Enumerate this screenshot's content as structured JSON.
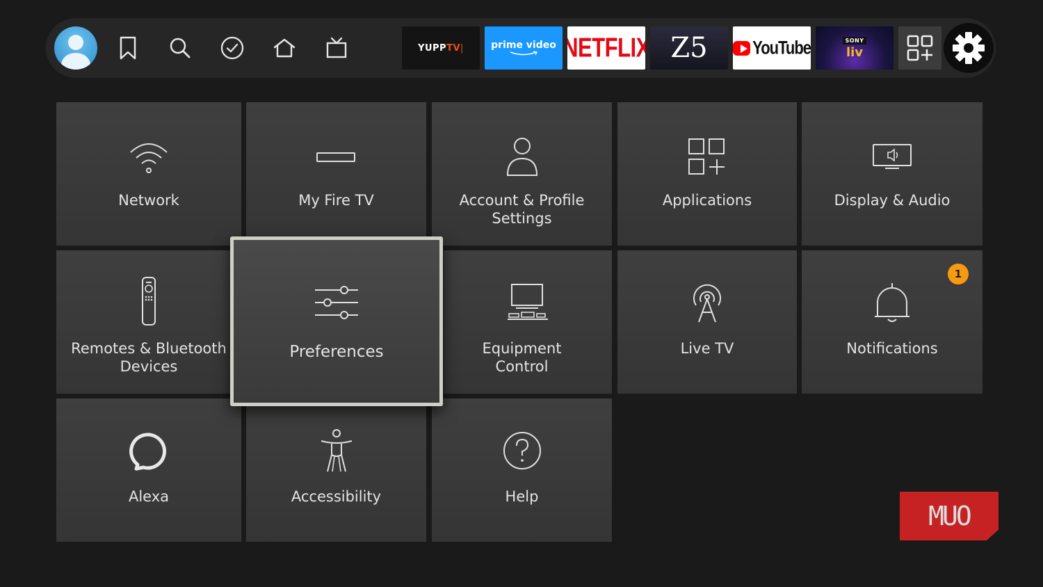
{
  "nav": {
    "items": [
      {
        "icon": "profile-avatar"
      },
      {
        "icon": "bookmark-icon"
      },
      {
        "icon": "search-icon"
      },
      {
        "icon": "checkmark-icon"
      },
      {
        "icon": "home-icon"
      },
      {
        "icon": "live-tv-icon"
      }
    ]
  },
  "apps": {
    "yupptv": {
      "main": "YUPP",
      "accent": "TV",
      "suffix": "|"
    },
    "prime": {
      "label": "prime video"
    },
    "netflix": {
      "label": "NETFLIX"
    },
    "z5": {
      "label": "Z5"
    },
    "youtube": {
      "label": "YouTube"
    },
    "sonyliv": {
      "brand": "SONY",
      "label": "liv"
    },
    "all_apps": {
      "icon": "all-apps-icon"
    },
    "settings": {
      "icon": "gear-icon"
    }
  },
  "tiles": [
    {
      "label": "Network",
      "icon": "wifi-icon"
    },
    {
      "label": "My Fire TV",
      "icon": "fire-tv-stick-icon"
    },
    {
      "label": "Account & Profile\nSettings",
      "icon": "person-icon"
    },
    {
      "label": "Applications",
      "icon": "apps-grid-icon"
    },
    {
      "label": "Display & Audio",
      "icon": "monitor-speaker-icon"
    },
    {
      "label": "Remotes & Bluetooth\nDevices",
      "icon": "remote-icon"
    },
    {
      "label": "Preferences",
      "icon": "sliders-icon",
      "focused": true
    },
    {
      "label": "Equipment\nControl",
      "icon": "equipment-icon"
    },
    {
      "label": "Live TV",
      "icon": "antenna-icon"
    },
    {
      "label": "Notifications",
      "icon": "bell-icon",
      "badge": "1"
    },
    {
      "label": "Alexa",
      "icon": "alexa-ring-icon"
    },
    {
      "label": "Accessibility",
      "icon": "accessibility-icon"
    },
    {
      "label": "Help",
      "icon": "help-icon"
    }
  ],
  "colors": {
    "background": "#1a1a1a",
    "tile": "#3c3c3c",
    "badge": "#f79a12",
    "prime": "#1a98ff",
    "netflix": "#e50914",
    "youtube": "#ff0000",
    "watermark": "#c62224"
  },
  "watermark": {
    "label": "MUO"
  }
}
